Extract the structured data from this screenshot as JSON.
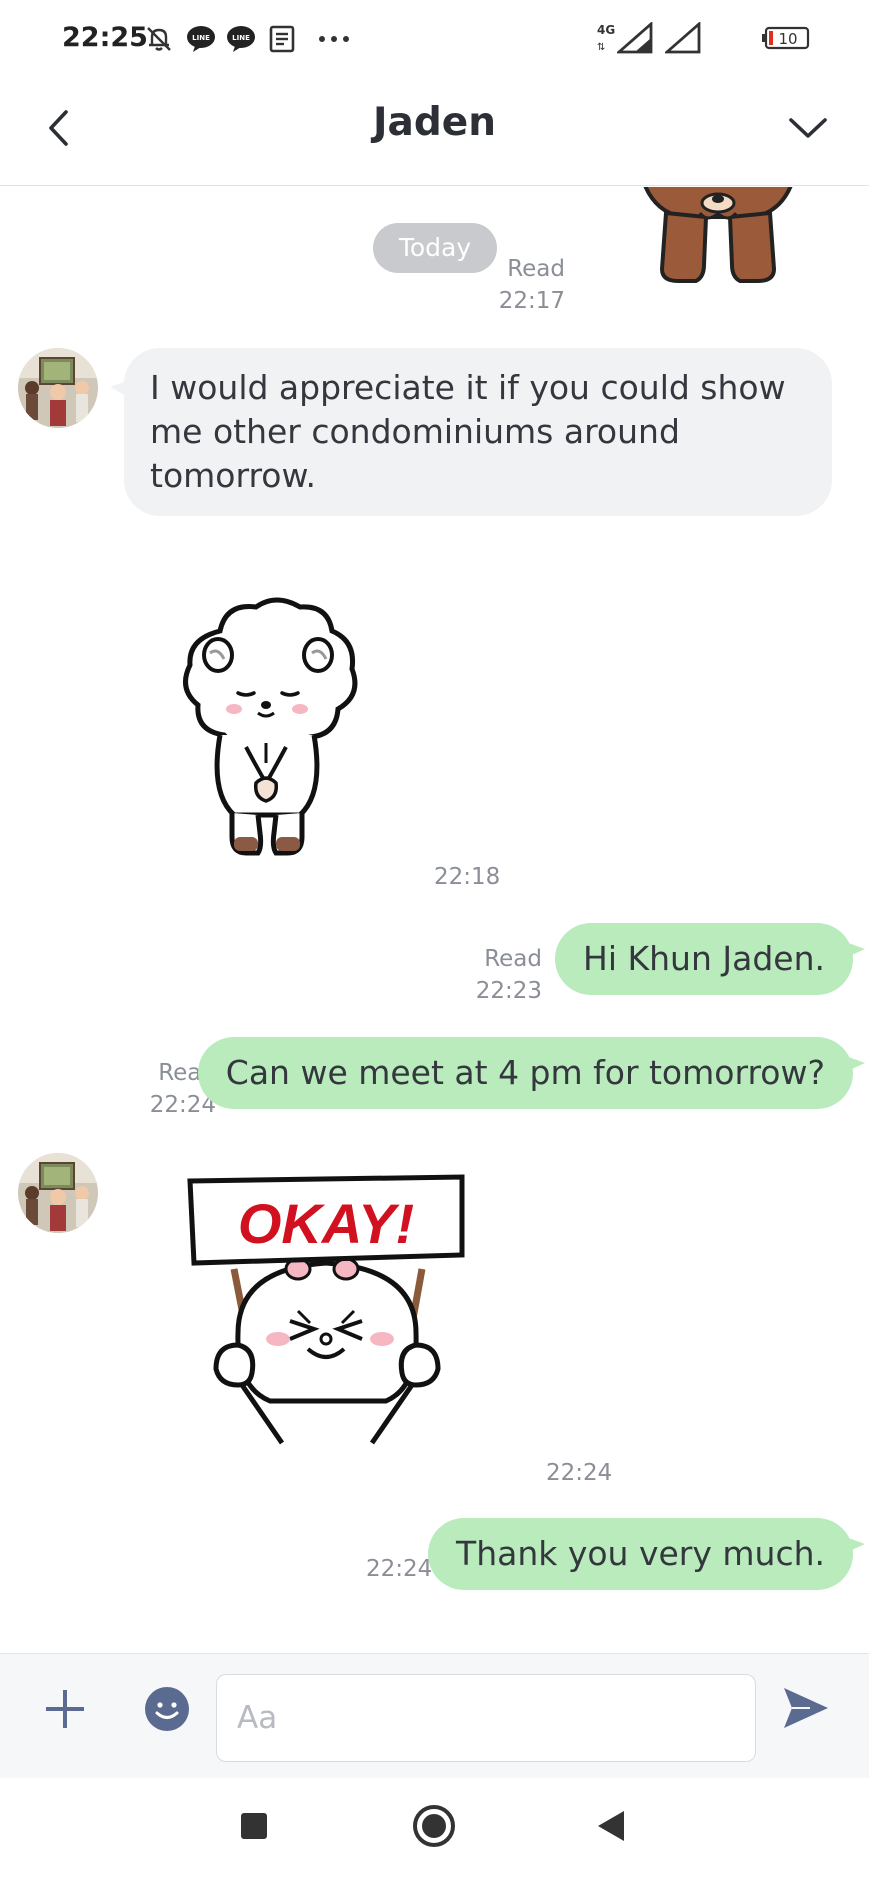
{
  "status_bar": {
    "time": "22:25",
    "network": "4G",
    "battery": "10",
    "icons": [
      "mute-icon",
      "line-icon",
      "line-icon",
      "news-icon",
      "more-dots-icon",
      "signal-icon",
      "signal-icon",
      "battery-icon"
    ]
  },
  "header": {
    "title": "Jaden"
  },
  "chat": {
    "date_divider": "Today",
    "messages": [
      {
        "type": "sticker",
        "side": "out",
        "sticker": "brown-bear-bow-sticker",
        "read": "Read",
        "time": "22:17"
      },
      {
        "type": "text",
        "side": "in",
        "text": "I would appreciate it if you could show me other condominiums around tomorrow."
      },
      {
        "type": "sticker",
        "side": "in",
        "sticker": "white-sheep-bow-sticker",
        "time": "22:18"
      },
      {
        "type": "text",
        "side": "out",
        "text": "Hi Khun Jaden.",
        "read": "Read",
        "time": "22:23"
      },
      {
        "type": "text",
        "side": "out",
        "text": "Can we meet at 4 pm for tomorrow?",
        "read": "Read",
        "time": "22:24"
      },
      {
        "type": "sticker",
        "side": "in",
        "sticker": "okay-sign-sticker",
        "sticker_text": "OKAY!",
        "time": "22:24"
      },
      {
        "type": "text",
        "side": "out",
        "text": "Thank you very much.",
        "time": "22:24"
      }
    ]
  },
  "composer": {
    "placeholder": "Aa",
    "value": ""
  },
  "colors": {
    "outgoing_bubble": "#b9ebbc",
    "incoming_bubble": "#f1f2f4",
    "accent": "#5b6a90"
  }
}
